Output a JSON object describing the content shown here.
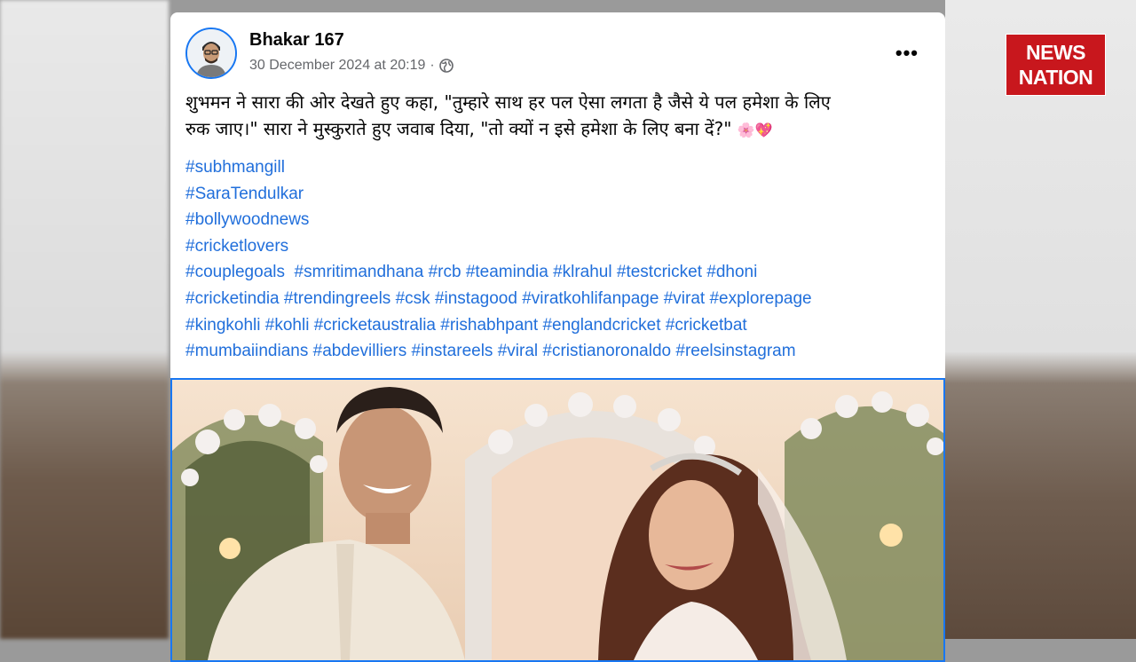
{
  "brand": {
    "line1": "NEWS",
    "line2": "NATION"
  },
  "post": {
    "author": "Bhakar 167",
    "timestamp": "30 December 2024 at 20:19",
    "separator": "·",
    "text_line1": "शुभमन ने सारा की ओर देखते हुए कहा, \"तुम्हारे साथ हर पल ऐसा लगता है जैसे ये पल हमेशा के लिए",
    "text_line2": "रुक जाए।\" सारा ने मुस्कुराते हुए जवाब दिया, \"तो क्यों न इसे हमेशा के लिए बना दें?\"",
    "emojis": "🌸💖",
    "hashtag_lines": [
      [
        "#subhmangill"
      ],
      [
        "#SaraTendulkar"
      ],
      [
        "#bollywoodnews"
      ],
      [
        "#cricketlovers"
      ],
      [
        "#couplegoals",
        "#smritimandhana",
        "#rcb",
        "#teamindia",
        "#klrahul",
        "#testcricket",
        "#dhoni"
      ],
      [
        "#cricketindia",
        "#trendingreels",
        "#csk",
        "#instagood",
        "#viratkohlifanpage",
        "#virat",
        "#explorepage"
      ],
      [
        "#kingkohli",
        "#kohli",
        "#cricketaustralia",
        "#rishabhpant",
        "#englandcricket",
        "#cricketbat"
      ],
      [
        "#mumbaiindians",
        "#abdevilliers",
        "#instareels",
        "#viral",
        "#cristianoronaldo",
        "#reelsinstagram"
      ]
    ]
  },
  "icons": {
    "more": "more-options-icon",
    "privacy": "globe-icon",
    "avatar": "profile-avatar"
  },
  "colors": {
    "link": "#216fdb",
    "brand": "#c8171d",
    "focus": "#1877f2"
  }
}
